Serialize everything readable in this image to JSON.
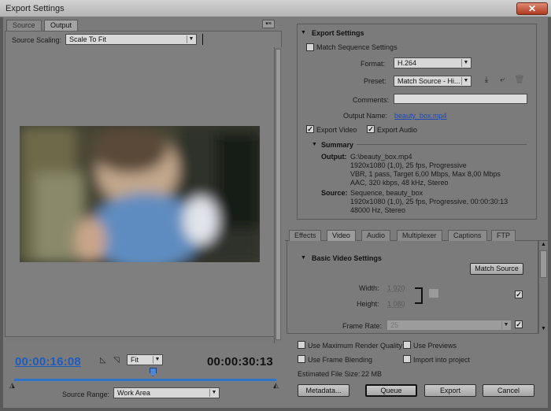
{
  "window": {
    "title": "Export Settings",
    "close_glyph": "✕"
  },
  "left": {
    "tabs": [
      {
        "label": "Source"
      },
      {
        "label": "Output"
      }
    ],
    "panel_menu_glyph": "▾≡",
    "source_scaling": {
      "label": "Source Scaling:",
      "value": "Scale To Fit"
    },
    "current_time": "00:00:16:08",
    "zoom": {
      "value": "Fit"
    },
    "duration": "00:00:30:13",
    "source_range": {
      "label": "Source Range:",
      "value": "Work Area"
    }
  },
  "export_settings": {
    "header": "Export Settings",
    "match_sequence": {
      "label": "Match Sequence Settings",
      "checked": false
    },
    "format": {
      "label": "Format:",
      "value": "H.264"
    },
    "preset": {
      "label": "Preset:",
      "value": "Match Source - Hi..."
    },
    "comments": {
      "label": "Comments:",
      "value": ""
    },
    "output_name": {
      "label": "Output Name:",
      "value": "beauty_box.mp4"
    },
    "export_video": {
      "label": "Export Video",
      "checked": true
    },
    "export_audio": {
      "label": "Export Audio",
      "checked": true
    }
  },
  "summary": {
    "header": "Summary",
    "output_label": "Output:",
    "output_lines": [
      "G:\\beauty_box.mp4",
      "1920x1080 (1,0), 25 fps, Progressive",
      "VBR, 1 pass, Target 6,00 Mbps, Max 8,00 Mbps",
      "AAC, 320 kbps, 48 kHz, Stereo"
    ],
    "source_label": "Source:",
    "source_lines": [
      "Sequence, beauty_box",
      "1920x1080 (1,0), 25 fps, Progressive, 00:00:30:13",
      "48000 Hz, Stereo"
    ]
  },
  "video_tabs": [
    {
      "label": "Effects"
    },
    {
      "label": "Video"
    },
    {
      "label": "Audio"
    },
    {
      "label": "Multiplexer"
    },
    {
      "label": "Captions"
    },
    {
      "label": "FTP"
    }
  ],
  "basic_video": {
    "header": "Basic Video Settings",
    "match_source_button": "Match Source",
    "width": {
      "label": "Width:",
      "value": "1 920"
    },
    "height": {
      "label": "Height:",
      "value": "1 080"
    },
    "frame_rate": {
      "label": "Frame Rate:",
      "value": "25"
    }
  },
  "bottom_options": {
    "max_render_quality": {
      "label": "Use Maximum Render Quality",
      "checked": false
    },
    "use_previews": {
      "label": "Use Previews",
      "checked": false
    },
    "frame_blending": {
      "label": "Use Frame Blending",
      "checked": false
    },
    "import_into_project": {
      "label": "Import into project",
      "checked": false
    },
    "estimated_file_size": {
      "label": "Estimated File Size:",
      "value": "22 MB"
    }
  },
  "buttons": {
    "metadata": "Metadata...",
    "queue": "Queue",
    "export": "Export",
    "cancel": "Cancel"
  },
  "colors": {
    "accent": "#2f74c8",
    "link": "#1f49b5",
    "panel": "#7b7b7b"
  }
}
